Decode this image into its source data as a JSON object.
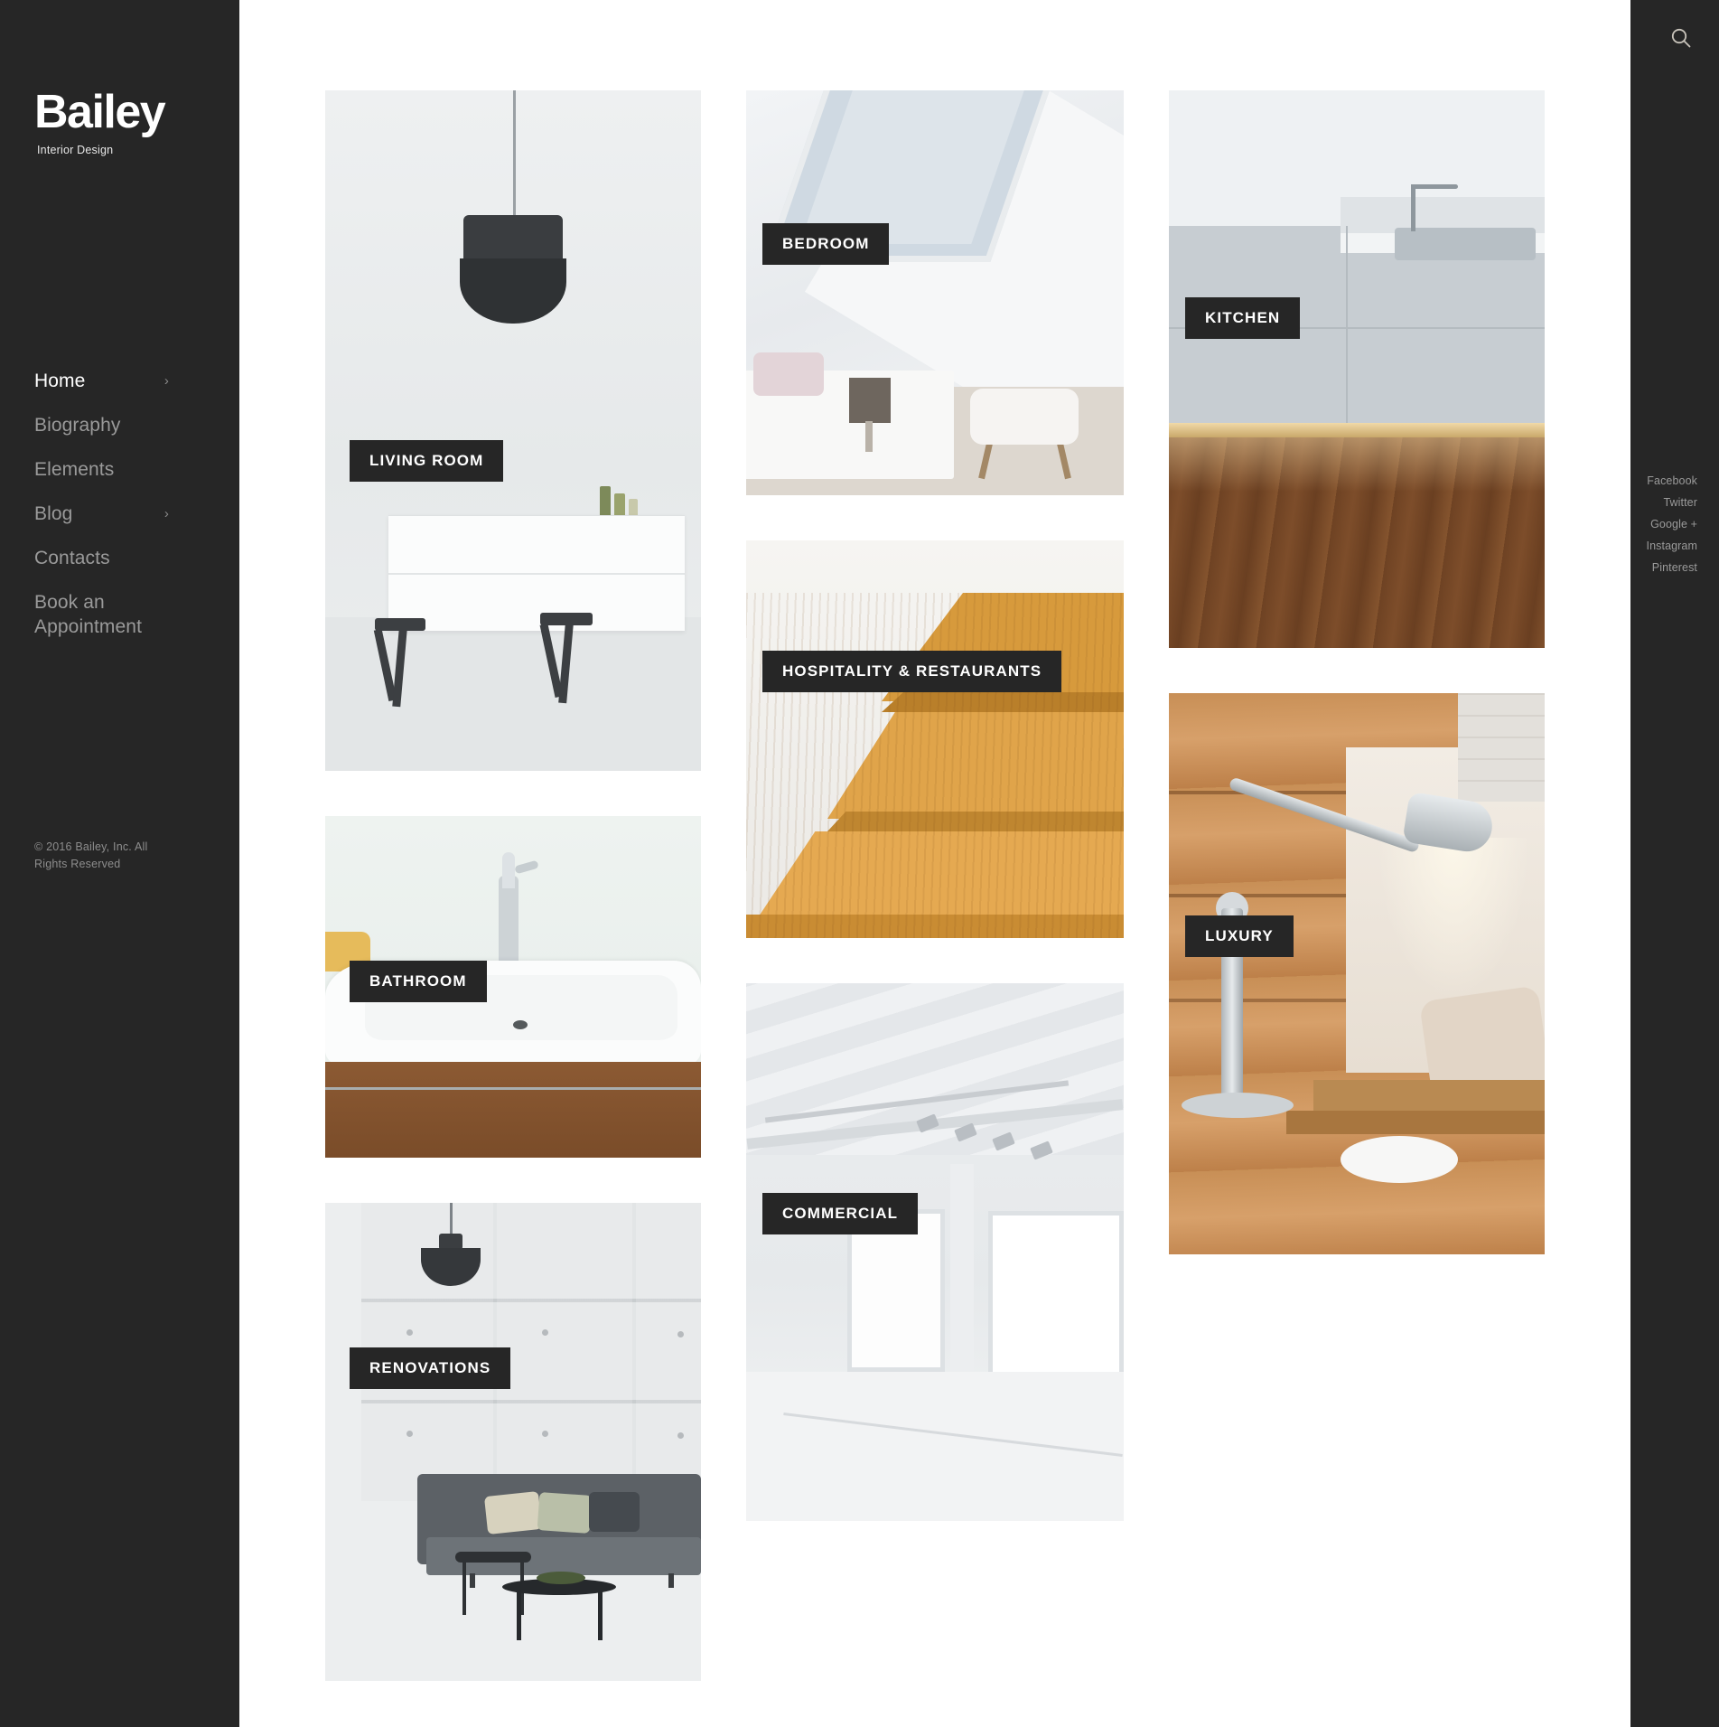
{
  "site": {
    "logo_title": "Bailey",
    "logo_subtitle": "Interior Design",
    "copyright": "© 2016 Bailey, Inc. All Rights Reserved",
    "colors": {
      "sidebar_bg": "#262626",
      "page_bg": "#ffffff",
      "label_bg": "#262626",
      "label_text": "#ffffff",
      "nav_active": "#ffffff",
      "nav_inactive": "#9a9a9a"
    }
  },
  "sidebar": {
    "items": [
      {
        "label": "Home",
        "active": true,
        "has_submenu": true,
        "chevron": "›"
      },
      {
        "label": "Biography",
        "active": false,
        "has_submenu": false,
        "chevron": ""
      },
      {
        "label": "Elements",
        "active": false,
        "has_submenu": false,
        "chevron": ""
      },
      {
        "label": "Blog",
        "active": false,
        "has_submenu": true,
        "chevron": "›"
      },
      {
        "label": "Contacts",
        "active": false,
        "has_submenu": false,
        "chevron": ""
      },
      {
        "label": "Book an Appointment",
        "active": false,
        "has_submenu": false,
        "chevron": ""
      }
    ]
  },
  "right_rail": {
    "search_icon": "search-icon",
    "social": [
      {
        "label": "Facebook"
      },
      {
        "label": "Twitter"
      },
      {
        "label": "Google +"
      },
      {
        "label": "Instagram"
      },
      {
        "label": "Pinterest"
      }
    ]
  },
  "gallery": {
    "tiles": [
      {
        "id": "living",
        "label": "LIVING ROOM"
      },
      {
        "id": "bathroom",
        "label": "BATHROOM"
      },
      {
        "id": "renovate",
        "label": "RENOVATIONS"
      },
      {
        "id": "bedroom",
        "label": "BEDROOM"
      },
      {
        "id": "hosp",
        "label": "HOSPITALITY & RESTAURANTS"
      },
      {
        "id": "commercial",
        "label": "COMMERCIAL"
      },
      {
        "id": "kitchen",
        "label": "KITCHEN"
      },
      {
        "id": "luxury",
        "label": "LUXURY"
      }
    ]
  }
}
